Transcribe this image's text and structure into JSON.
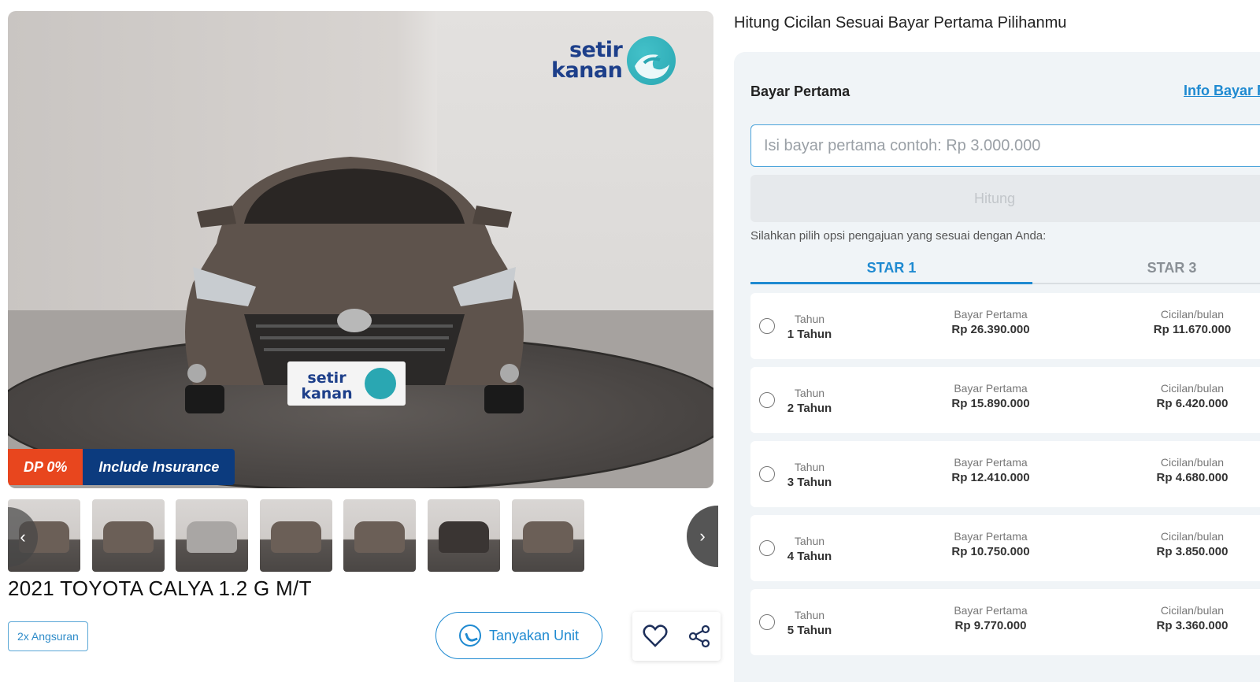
{
  "gallery": {
    "brand_logo": "setir kanan",
    "brand_logo_line1": "setir",
    "brand_logo_line2": "kanan",
    "badge_dp": "DP 0%",
    "badge_insurance": "Include Insurance",
    "thumbnail_count": 7,
    "prev_icon": "chevron-left-icon",
    "next_icon": "chevron-right-icon"
  },
  "listing": {
    "title": "2021 TOYOTA CALYA 1.2 G M/T",
    "chip_label": "2x Angsuran",
    "ask_button_label": "Tanyakan Unit",
    "ask_button_icon": "whatsapp-icon",
    "favorite_icon": "heart-icon",
    "share_icon": "share-icon"
  },
  "calculator": {
    "heading": "Hitung Cicilan Sesuai Bayar Pertama Pilihanmu",
    "down_payment_label": "Bayar Pertama",
    "info_link": "Info Bayar P",
    "input_value": "",
    "input_placeholder": "Isi bayar pertama contoh: Rp 3.000.000",
    "calculate_button": "Hitung",
    "hint": "Silahkan pilih opsi pengajuan yang sesuai dengan Anda:",
    "tabs": [
      {
        "label": "STAR 1",
        "active": true
      },
      {
        "label": "STAR 3",
        "active": false
      }
    ],
    "column_labels": {
      "tenor": "Tahun",
      "down_payment": "Bayar Pertama",
      "installment": "Cicilan/bulan"
    },
    "options": [
      {
        "tenor": "1 Tahun",
        "down_payment": "Rp 26.390.000",
        "installment": "Rp 11.670.000"
      },
      {
        "tenor": "2 Tahun",
        "down_payment": "Rp 15.890.000",
        "installment": "Rp 6.420.000"
      },
      {
        "tenor": "3 Tahun",
        "down_payment": "Rp 12.410.000",
        "installment": "Rp 4.680.000"
      },
      {
        "tenor": "4 Tahun",
        "down_payment": "Rp 10.750.000",
        "installment": "Rp 3.850.000"
      },
      {
        "tenor": "5 Tahun",
        "down_payment": "Rp 9.770.000",
        "installment": "Rp 3.360.000"
      }
    ]
  },
  "colors": {
    "accent": "#1f8ad1",
    "badge_dp": "#e8461e",
    "badge_insurance": "#0c3b7e",
    "panel_bg": "#f0f4f7"
  }
}
